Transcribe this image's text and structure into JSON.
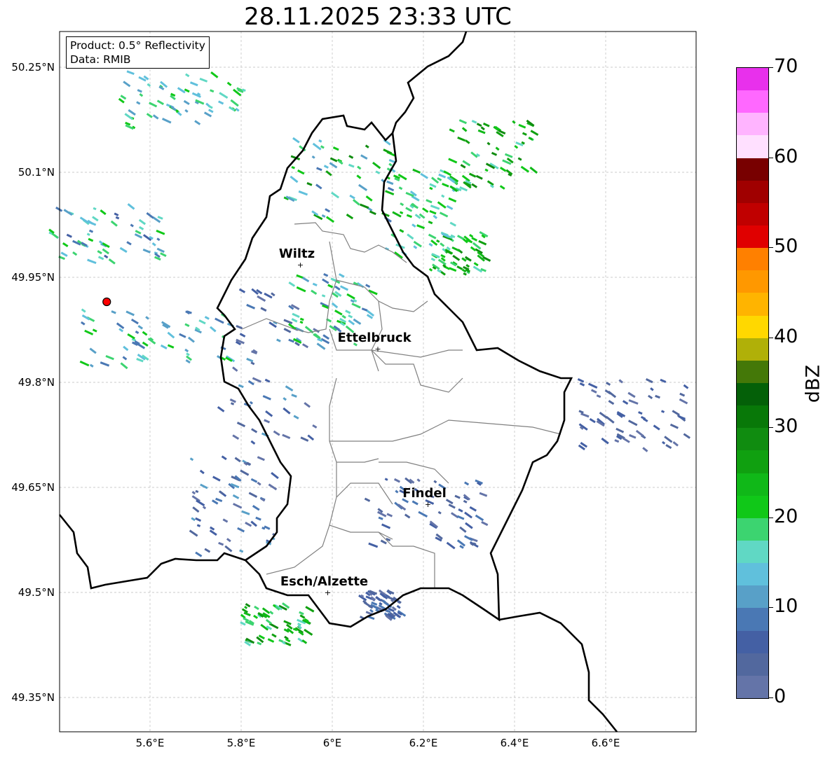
{
  "title": "28.11.2025 23:33 UTC",
  "legend": {
    "product": "Product: 0.5° Reflectivity",
    "data": "Data: RMIB"
  },
  "lat_labels": [
    {
      "v": 50.25,
      "t": "50.25°N"
    },
    {
      "v": 50.1,
      "t": "50.1°N"
    },
    {
      "v": 49.95,
      "t": "49.95°N"
    },
    {
      "v": 49.8,
      "t": "49.8°N"
    },
    {
      "v": 49.65,
      "t": "49.65°N"
    },
    {
      "v": 49.5,
      "t": "49.5°N"
    },
    {
      "v": 49.35,
      "t": "49.35°N"
    }
  ],
  "lon_labels": [
    {
      "v": 5.6,
      "t": "5.6°E"
    },
    {
      "v": 5.8,
      "t": "5.8°E"
    },
    {
      "v": 6.0,
      "t": "6°E"
    },
    {
      "v": 6.2,
      "t": "6.2°E"
    },
    {
      "v": 6.4,
      "t": "6.4°E"
    },
    {
      "v": 6.6,
      "t": "6.6°E"
    }
  ],
  "cities": [
    {
      "name": "Wiltz",
      "lon": 5.93,
      "lat": 49.968
    },
    {
      "name": "Ettelbruck",
      "lon": 6.1,
      "lat": 49.848
    },
    {
      "name": "Findel",
      "lon": 6.21,
      "lat": 49.626
    },
    {
      "name": "Esch/Alzette",
      "lon": 5.99,
      "lat": 49.5
    }
  ],
  "radar_site": {
    "lon": 5.505,
    "lat": 49.915,
    "color": "#ff0000"
  },
  "colorbar": {
    "label": "dBZ",
    "min": 0,
    "max": 70,
    "step": 2.5,
    "ticks": [
      "0",
      "10",
      "20",
      "30",
      "40",
      "50",
      "60",
      "70"
    ],
    "colors": [
      "#6474a8",
      "#52689e",
      "#4460a4",
      "#4a78b4",
      "#58a0c8",
      "#60c0dc",
      "#60d8c4",
      "#3cd470",
      "#10c818",
      "#10b818",
      "#10a010",
      "#108c10",
      "#087808",
      "#046008",
      "#447808",
      "#b0b008",
      "#ffd800",
      "#ffb400",
      "#ff9800",
      "#ff8000",
      "#e00000",
      "#c00000",
      "#a00000",
      "#780000",
      "#ffe0ff",
      "#ffb4ff",
      "#ff68ff",
      "#e830ec"
    ]
  }
}
